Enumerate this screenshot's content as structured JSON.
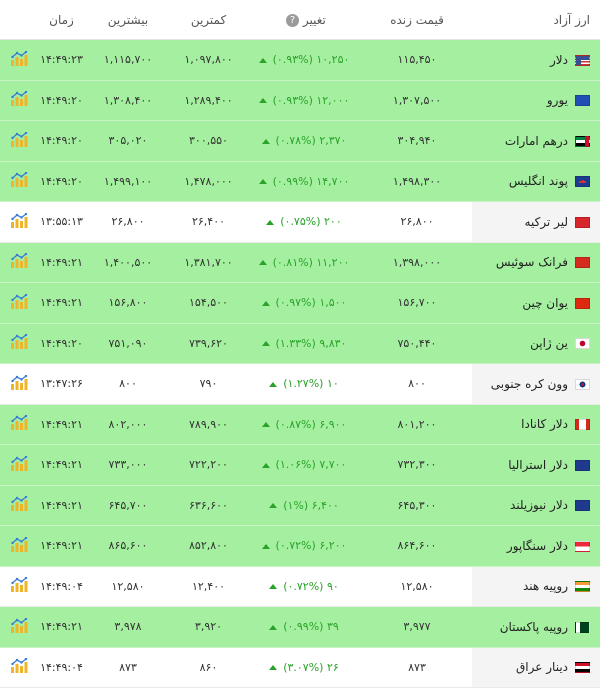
{
  "headers": {
    "name": "ارز آزاد",
    "live_price": "قیمت زنده",
    "change": "تغییر",
    "change_help": "?",
    "low": "کمترین",
    "high": "بیشترین",
    "time": "زمان"
  },
  "colors": {
    "up_row": "#a5f0a0",
    "neutral_row": "#ffffff",
    "change_text": "#29a329"
  },
  "rows": [
    {
      "name": "دلار",
      "flag": "us-flag",
      "price": "۱۱۵,۴۵۰",
      "change": "۱۰,۲۵۰ (۰.۹۳%)",
      "low": "۱,۰۹۷,۸۰۰",
      "high": "۱,۱۱۵,۷۰۰",
      "time": "۱۴:۴۹:۲۳",
      "state": "up"
    },
    {
      "name": "یورو",
      "flag": "eu-flag",
      "price": "۱,۳۰۷,۵۰۰",
      "change": "۱۲,۰۰۰ (۰.۹۳%)",
      "low": "۱,۲۸۹,۴۰۰",
      "high": "۱,۳۰۸,۴۰۰",
      "time": "۱۴:۴۹:۲۰",
      "state": "up"
    },
    {
      "name": "درهم امارات",
      "flag": "ae-flag",
      "price": "۳۰۴,۹۴۰",
      "change": "۲,۳۷۰ (۰.۷۸%)",
      "low": "۳۰۰,۵۵۰",
      "high": "۳۰۵,۰۲۰",
      "time": "۱۴:۴۹:۲۰",
      "state": "up"
    },
    {
      "name": "پوند انگلیس",
      "flag": "gb-flag",
      "price": "۱,۴۹۸,۳۰۰",
      "change": "۱۴,۷۰۰ (۰.۹۹%)",
      "low": "۱,۴۷۸,۰۰۰",
      "high": "۱,۴۹۹,۱۰۰",
      "time": "۱۴:۴۹:۲۰",
      "state": "up"
    },
    {
      "name": "لیر ترکیه",
      "flag": "tr-flag",
      "price": "۲۶,۸۰۰",
      "change": "۲۰۰ (۰.۷۵%)",
      "low": "۲۶,۴۰۰",
      "high": "۲۶,۸۰۰",
      "time": "۱۳:۵۵:۱۳",
      "state": "neutral"
    },
    {
      "name": "فرانک سوئیس",
      "flag": "ch-flag",
      "price": "۱,۳۹۸,۰۰۰",
      "change": "۱۱,۲۰۰ (۰.۸۱%)",
      "low": "۱,۳۸۱,۷۰۰",
      "high": "۱,۴۰۰,۵۰۰",
      "time": "۱۴:۴۹:۲۱",
      "state": "up"
    },
    {
      "name": "یوان چین",
      "flag": "cn-flag",
      "price": "۱۵۶,۷۰۰",
      "change": "۱,۵۰۰ (۰.۹۷%)",
      "low": "۱۵۴,۵۰۰",
      "high": "۱۵۶,۸۰۰",
      "time": "۱۴:۴۹:۲۱",
      "state": "up"
    },
    {
      "name": "ین ژاپن",
      "flag": "jp-flag",
      "price": "۷۵۰,۴۴۰",
      "change": "۹,۸۳۰ (۱.۳۳%)",
      "low": "۷۳۹,۶۲۰",
      "high": "۷۵۱,۰۹۰",
      "time": "۱۴:۴۹:۲۰",
      "state": "up"
    },
    {
      "name": "وون کره جنوبی",
      "flag": "kr-flag",
      "price": "۸۰۰",
      "change": "۱۰ (۱.۲۷%)",
      "low": "۷۹۰",
      "high": "۸۰۰",
      "time": "۱۳:۴۷:۲۶",
      "state": "neutral"
    },
    {
      "name": "دلار کانادا",
      "flag": "ca-flag",
      "price": "۸۰۱,۲۰۰",
      "change": "۶,۹۰۰ (۰.۸۷%)",
      "low": "۷۸۹,۹۰۰",
      "high": "۸۰۲,۰۰۰",
      "time": "۱۴:۴۹:۲۱",
      "state": "up"
    },
    {
      "name": "دلار استرالیا",
      "flag": "au-flag",
      "price": "۷۳۲,۳۰۰",
      "change": "۷,۷۰۰ (۱.۰۶%)",
      "low": "۷۲۲,۲۰۰",
      "high": "۷۳۳,۰۰۰",
      "time": "۱۴:۴۹:۲۱",
      "state": "up"
    },
    {
      "name": "دلار نیوزیلند",
      "flag": "nz-flag",
      "price": "۶۴۵,۳۰۰",
      "change": "۶,۴۰۰ (۱%)",
      "low": "۶۳۶,۶۰۰",
      "high": "۶۴۵,۷۰۰",
      "time": "۱۴:۴۹:۲۱",
      "state": "up"
    },
    {
      "name": "دلار سنگاپور",
      "flag": "sg-flag",
      "price": "۸۶۴,۶۰۰",
      "change": "۶,۲۰۰ (۰.۷۲%)",
      "low": "۸۵۲,۸۰۰",
      "high": "۸۶۵,۶۰۰",
      "time": "۱۴:۴۹:۲۱",
      "state": "up"
    },
    {
      "name": "روپیه هند",
      "flag": "in-flag",
      "price": "۱۲,۵۸۰",
      "change": "۹۰ (۰.۷۲%)",
      "low": "۱۲,۴۰۰",
      "high": "۱۲,۵۸۰",
      "time": "۱۴:۴۹:۰۴",
      "state": "neutral"
    },
    {
      "name": "روپیه پاکستان",
      "flag": "pk-flag",
      "price": "۳,۹۷۷",
      "change": "۳۹ (۰.۹۹%)",
      "low": "۳,۹۲۰",
      "high": "۳,۹۷۸",
      "time": "۱۴:۴۹:۲۱",
      "state": "up"
    },
    {
      "name": "دینار عراق",
      "flag": "iq-flag",
      "price": "۸۷۳",
      "change": "۲۶ (۳.۰۷%)",
      "low": "۸۶۰",
      "high": "۸۷۳",
      "time": "۱۴:۴۹:۰۴",
      "state": "neutral"
    }
  ]
}
